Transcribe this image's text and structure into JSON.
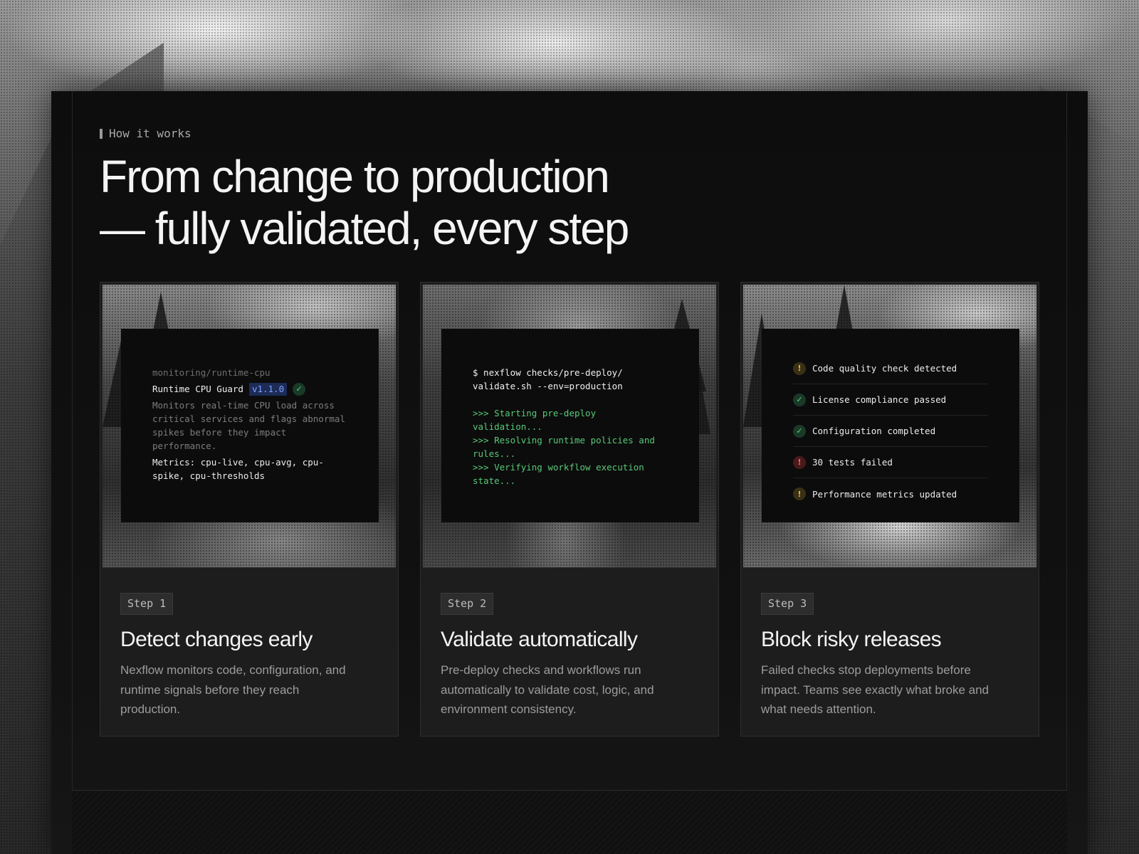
{
  "section": {
    "eyebrow": "How it works",
    "headline_line1": "From change to production",
    "headline_line2": "— fully validated, every step"
  },
  "cards": [
    {
      "terminal": {
        "path": "monitoring/runtime-cpu",
        "name": "Runtime CPU Guard",
        "version": "v1.1.0",
        "status_icon": "check-icon",
        "description": "Monitors real-time CPU load across critical services and flags abnormal spikes before they impact performance.",
        "metrics": "Metrics: cpu-live, cpu-avg, cpu-spike, cpu-thresholds"
      },
      "step": "Step 1",
      "title": "Detect changes early",
      "text": "Nexflow monitors code, configuration, and runtime signals before they reach production."
    },
    {
      "terminal": {
        "command": "$ nexflow checks/pre-deploy/ validate.sh --env=production",
        "lines": [
          ">>> Starting pre-deploy validation...",
          ">>> Resolving runtime policies and rules...",
          ">>> Verifying workflow execution state..."
        ]
      },
      "step": "Step 2",
      "title": "Validate automatically",
      "text": "Pre-deploy checks and workflows run automatically to validate cost, logic, and environment consistency."
    },
    {
      "terminal": {
        "checks": [
          {
            "label": "Code quality check detected",
            "status": "warning",
            "icon": "warning-icon"
          },
          {
            "label": "License compliance passed",
            "status": "success",
            "icon": "check-icon"
          },
          {
            "label": "Configuration completed",
            "status": "success",
            "icon": "check-icon"
          },
          {
            "label": "30 tests failed",
            "status": "error",
            "icon": "error-icon"
          },
          {
            "label": "Performance metrics updated",
            "status": "warning",
            "icon": "warning-icon"
          }
        ]
      },
      "step": "Step 3",
      "title": "Block risky releases",
      "text": "Failed checks stop deployments before impact. Teams see exactly what broke and what needs attention."
    }
  ],
  "colors": {
    "panel": "#0d0d0d",
    "card": "#1d1d1d",
    "success": "#5fd08a",
    "warning": "#e2b341",
    "error": "#f06565",
    "terminal_output": "#58c978",
    "version_badge": "#7fa0ff"
  }
}
